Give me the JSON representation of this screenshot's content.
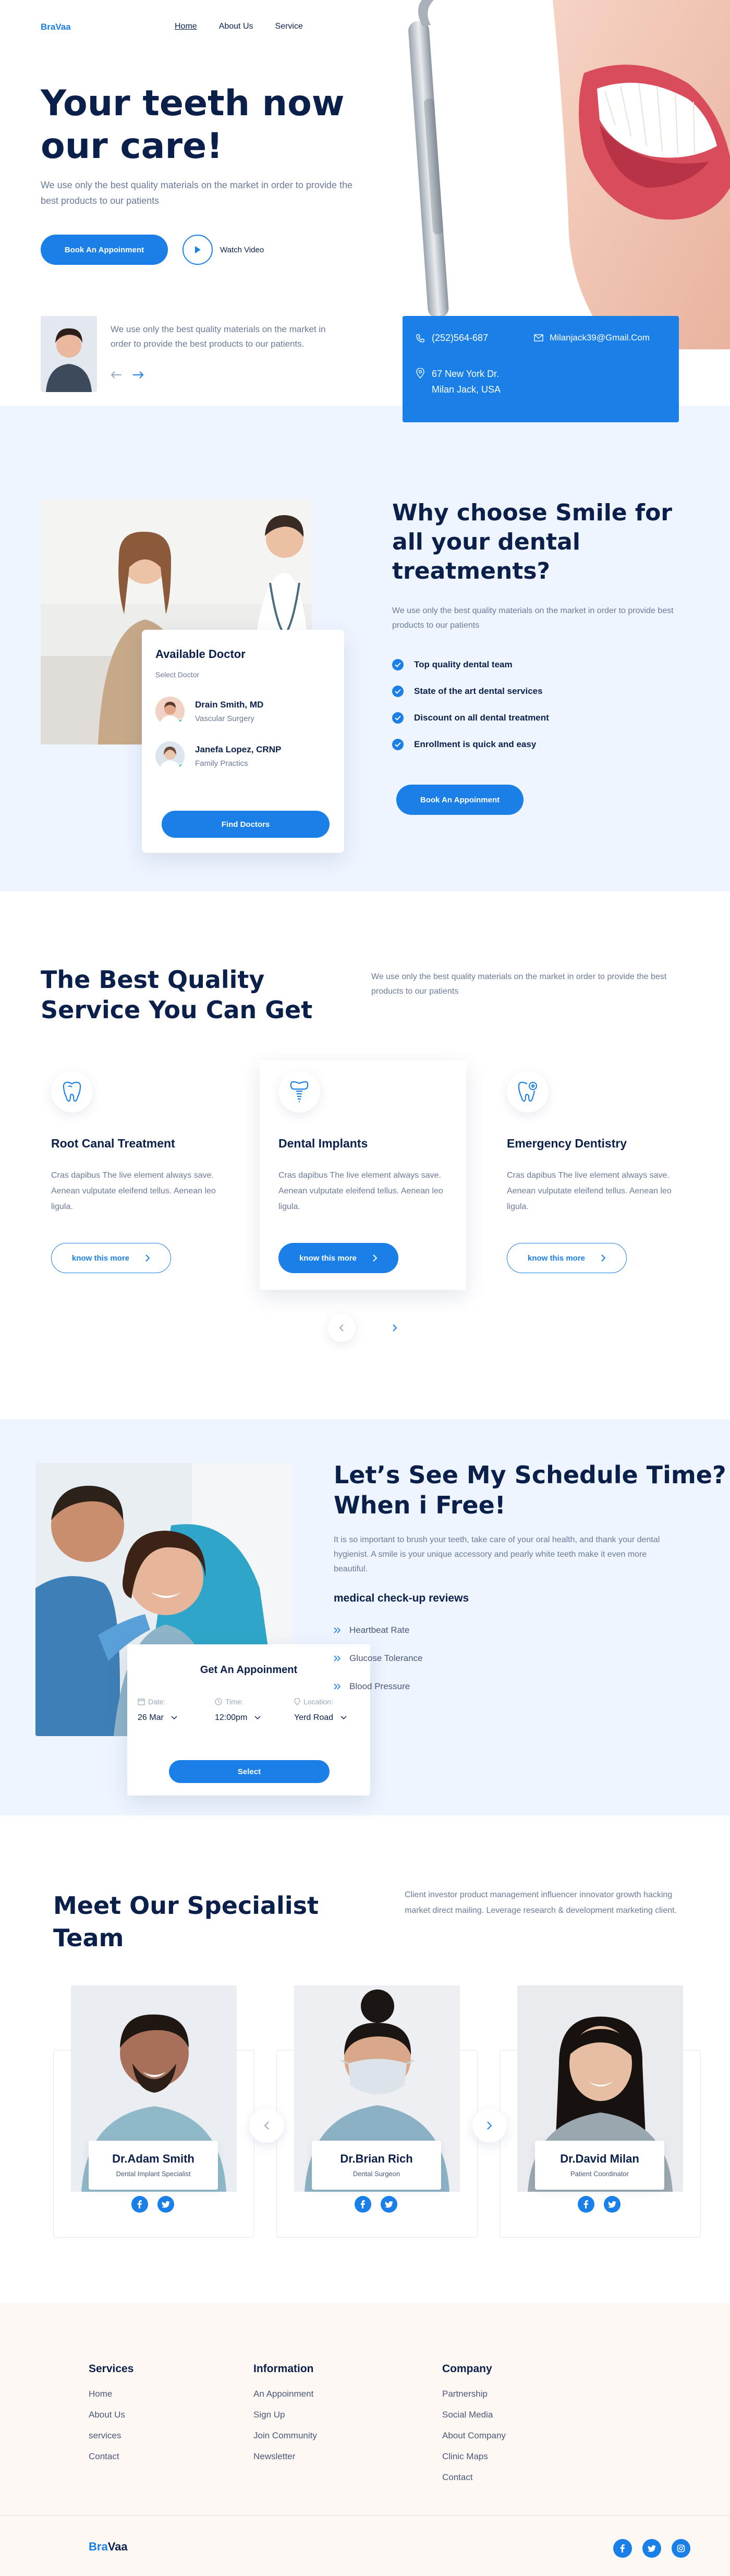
{
  "brand": {
    "part1": "Bra",
    "part2": "Vaa"
  },
  "nav": {
    "items": [
      {
        "label": "Home"
      },
      {
        "label": "About Us"
      },
      {
        "label": "Service"
      }
    ]
  },
  "hero": {
    "title_line1": "Your teeth now",
    "title_line2": "our care!",
    "subtitle": "We use only the best quality materials on the market in order to provide the best products to our patients",
    "cta": "Book An Appoinment",
    "watch": "Watch Video"
  },
  "testimonial": {
    "text": "We use only the best quality materials on the market in order to provide the best products to our patients."
  },
  "contact": {
    "phone": "(252)564-687",
    "email": "Milanjack39@Gmail.Com",
    "address_line1": "67 New York Dr.",
    "address_line2": "Milan Jack, USA"
  },
  "why": {
    "title_line1": "Why choose Smile for",
    "title_line2": "all your dental",
    "title_line3": "treatments?",
    "subtitle": "We use only the best quality materials on the market in order to provide  best products to our patients",
    "points": [
      "Top quality dental team",
      "State of the art dental services",
      "Discount on all dental treatment",
      "Enrollment is quick and easy"
    ],
    "cta": "Book An Appoinment",
    "doctor_card": {
      "title": "Available Doctor",
      "select": "Select Doctor",
      "doctors": [
        {
          "name": "Drain Smith, MD",
          "role": "Vascular Surgery"
        },
        {
          "name": "Janefa Lopez, CRNP",
          "role": "Family Practics"
        }
      ],
      "button": "Find Doctors"
    }
  },
  "services": {
    "title_line1": "The Best Quality",
    "title_line2": "Service You Can Get",
    "subtitle": "We use only the best quality materials on the market in order to provide the best products to our patients",
    "items": [
      {
        "title": "Root Canal Treatment",
        "desc": "Cras dapibus The live element always save. Aenean vulputate eleifend tellus. Aenean leo ligula.",
        "button": "know this more"
      },
      {
        "title": "Dental Implants",
        "desc": "Cras dapibus The live element always save. Aenean vulputate eleifend tellus. Aenean leo ligula.",
        "button": "know this more"
      },
      {
        "title": "Emergency Dentistry",
        "desc": "Cras dapibus The live element always save. Aenean vulputate eleifend tellus. Aenean leo ligula.",
        "button": "know this more"
      }
    ]
  },
  "schedule": {
    "title_line1": "Let’s See My Schedule Time?",
    "title_line2": "When i Free!",
    "desc": "It is so important to brush your teeth, take care of your oral health, and thank your dental hygienist. A smile is your unique accessory and pearly white teeth make it even more beautiful.",
    "reviews_title": "medical check-up reviews",
    "reviews": [
      "Heartbeat Rate",
      "Glucose Tolerance",
      "Blood Pressure"
    ],
    "card": {
      "title": "Get An Appoinment",
      "date_label": "Date:",
      "date_value": "26 Mar",
      "time_label": "Time:",
      "time_value": "12:00pm",
      "location_label": "Location:",
      "location_value": "Yerd Road",
      "button": "Select"
    }
  },
  "team": {
    "title_line1": "Meet Our Specialist",
    "title_line2": "Team",
    "subtitle": "Client investor product management influencer innovator growth hacking market direct mailing. Leverage research & development marketing client.",
    "members": [
      {
        "name": "Dr.Adam Smith",
        "role": "Dental Implant Specialist"
      },
      {
        "name": "Dr.Brian Rich",
        "role": "Dental Surgeon"
      },
      {
        "name": "Dr.David Milan",
        "role": "Patient Coordinator"
      }
    ]
  },
  "footer": {
    "services": {
      "title": "Services",
      "links": [
        "Home",
        "About Us",
        "services",
        "Contact"
      ]
    },
    "information": {
      "title": "Information",
      "links": [
        "An Appoinment",
        "Sign Up",
        "Join Community",
        "Newsletter"
      ]
    },
    "company": {
      "title": "Company",
      "links": [
        "Partnership",
        "Social Media",
        "About Company",
        "Clinic Maps",
        "Contact"
      ]
    }
  },
  "colors": {
    "accent": "#1A7FE6",
    "navy": "#0B1F4B",
    "light_bg": "#EEF5FF",
    "footer_bg": "#FDF8F4"
  }
}
